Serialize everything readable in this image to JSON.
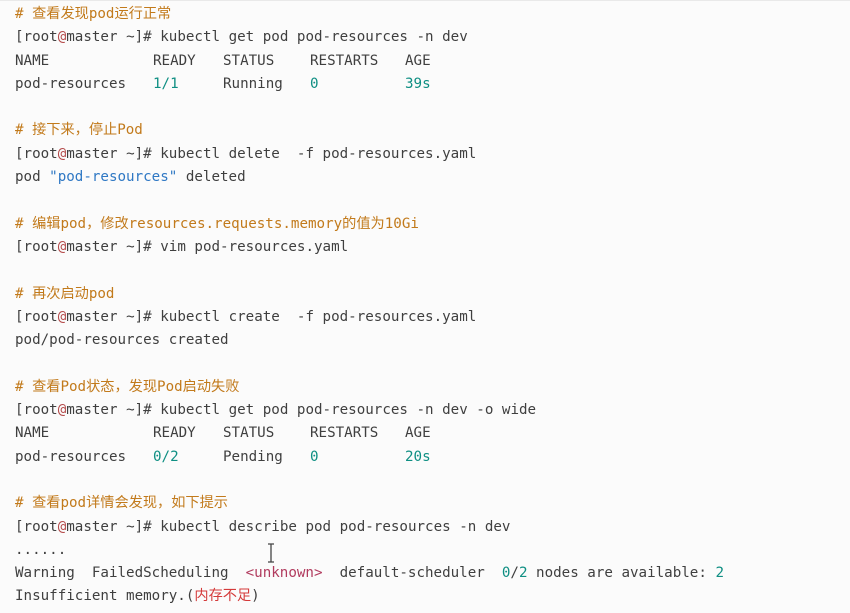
{
  "lines": {
    "c1": "# 查看发现pod运行正常",
    "p1": {
      "user": "root",
      "host": "master",
      "dir": "~",
      "cmd": "kubectl get pod pod-resources -n dev"
    },
    "h1": [
      "NAME",
      "READY",
      "STATUS",
      "RESTARTS",
      "AGE"
    ],
    "r1": [
      "pod-resources",
      "1/1",
      "Running",
      "0",
      "39s"
    ],
    "c2": "# 接下来，停止Pod",
    "p2": {
      "user": "root",
      "host": "master",
      "dir": "~",
      "cmd": "kubectl delete  -f pod-resources.yaml"
    },
    "o2": {
      "pre": "pod ",
      "str": "\"pod-resources\"",
      "post": " deleted"
    },
    "c3": "# 编辑pod，修改resources.requests.memory的值为10Gi",
    "p3": {
      "user": "root",
      "host": "master",
      "dir": "~",
      "cmd": "vim pod-resources.yaml"
    },
    "c4": "# 再次启动pod",
    "p4": {
      "user": "root",
      "host": "master",
      "dir": "~",
      "cmd": "kubectl create  -f pod-resources.yaml"
    },
    "o4": "pod/pod-resources created",
    "c5": "# 查看Pod状态，发现Pod启动失败",
    "p5": {
      "user": "root",
      "host": "master",
      "dir": "~",
      "cmd": "kubectl get pod pod-resources -n dev -o wide"
    },
    "h5": [
      "NAME",
      "READY",
      "STATUS",
      "RESTARTS",
      "AGE"
    ],
    "r5": [
      "pod-resources",
      "0/2",
      "Pending",
      "0",
      "20s"
    ],
    "c6": "# 查看pod详情会发现，如下提示",
    "p6": {
      "user": "root",
      "host": "master",
      "dir": "~",
      "cmd": "kubectl describe pod pod-resources -n dev"
    },
    "dots": "......",
    "w1": {
      "a": "Warning  FailedScheduling  ",
      "tag": "<unknown>",
      "b": "  default-scheduler  ",
      "n1": "0",
      "slash": "/",
      "n2": "2",
      "c": " nodes are available: ",
      "n3": "2"
    },
    "w2": {
      "a": "Insufficient memory.(",
      "red": "内存不足",
      "b": ")"
    }
  },
  "colors": {
    "comment": "#c27a1b",
    "number": "#0f8f83",
    "string": "#2f78c4",
    "at": "#b44a4a",
    "tag": "#b13b5e",
    "red": "#d43a3a"
  }
}
